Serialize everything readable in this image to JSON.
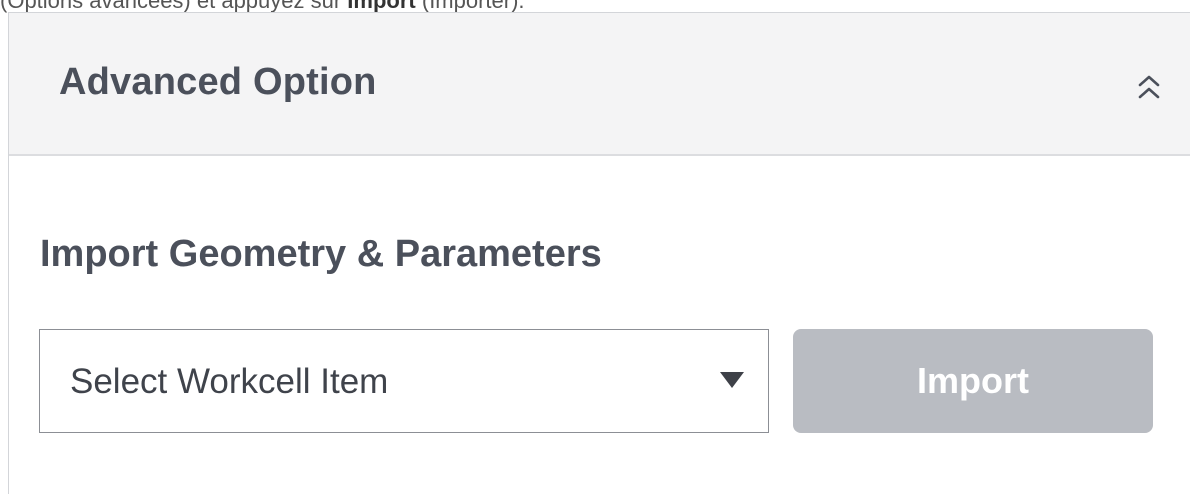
{
  "caption": {
    "prefix": "(Options avancées) et appuyez sur ",
    "bold": "Import",
    "suffix": " (Importer)."
  },
  "panel": {
    "title": "Advanced Option",
    "collapse_icon": "double-chevron-up-icon"
  },
  "import_section": {
    "title": "Import Geometry & Parameters",
    "select": {
      "value": "Select Workcell Item",
      "icon": "caret-down-icon"
    },
    "import_button_label": "Import",
    "import_button_state": "disabled"
  },
  "colors": {
    "header_bg": "#f4f4f5",
    "text": "#4b505b",
    "button_disabled": "#b9bcc2"
  }
}
